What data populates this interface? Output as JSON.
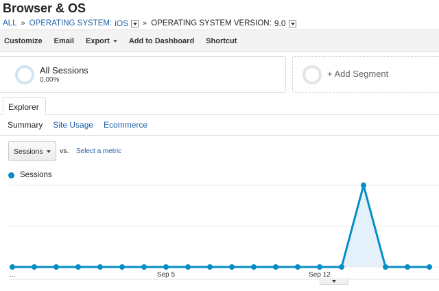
{
  "page": {
    "title": "Browser & OS"
  },
  "breadcrumb": {
    "all": "ALL",
    "sep": "»",
    "dim1_label": "OPERATING SYSTEM:",
    "dim1_value": "iOS",
    "dim2_label": "OPERATING SYSTEM VERSION:",
    "dim2_value": "9.0"
  },
  "toolbar": {
    "customize": "Customize",
    "email": "Email",
    "export": "Export",
    "add_to_dashboard": "Add to Dashboard",
    "shortcut": "Shortcut"
  },
  "segments": {
    "active": {
      "name": "All Sessions",
      "percent": "0.00%"
    },
    "add_label": "+ Add Segment"
  },
  "tabs": {
    "explorer": "Explorer"
  },
  "subtabs": [
    "Summary",
    "Site Usage",
    "Ecommerce"
  ],
  "metric": {
    "selected": "Sessions",
    "vs": "vs.",
    "select_metric": "Select a metric"
  },
  "colors": {
    "series": "#058dc7",
    "area_fill": "#e5f1fa",
    "link": "#1a5fa8"
  },
  "chart_data": {
    "type": "line",
    "x_tick_labels": [
      "...",
      "Sep 5",
      "Sep 12"
    ],
    "series": [
      {
        "name": "Sessions",
        "values": [
          0,
          0,
          0,
          0,
          0,
          0,
          0,
          0,
          0,
          0,
          0,
          0,
          0,
          0,
          0,
          0,
          1,
          0,
          0,
          0
        ]
      }
    ],
    "grid": true,
    "legend": "top-left"
  }
}
